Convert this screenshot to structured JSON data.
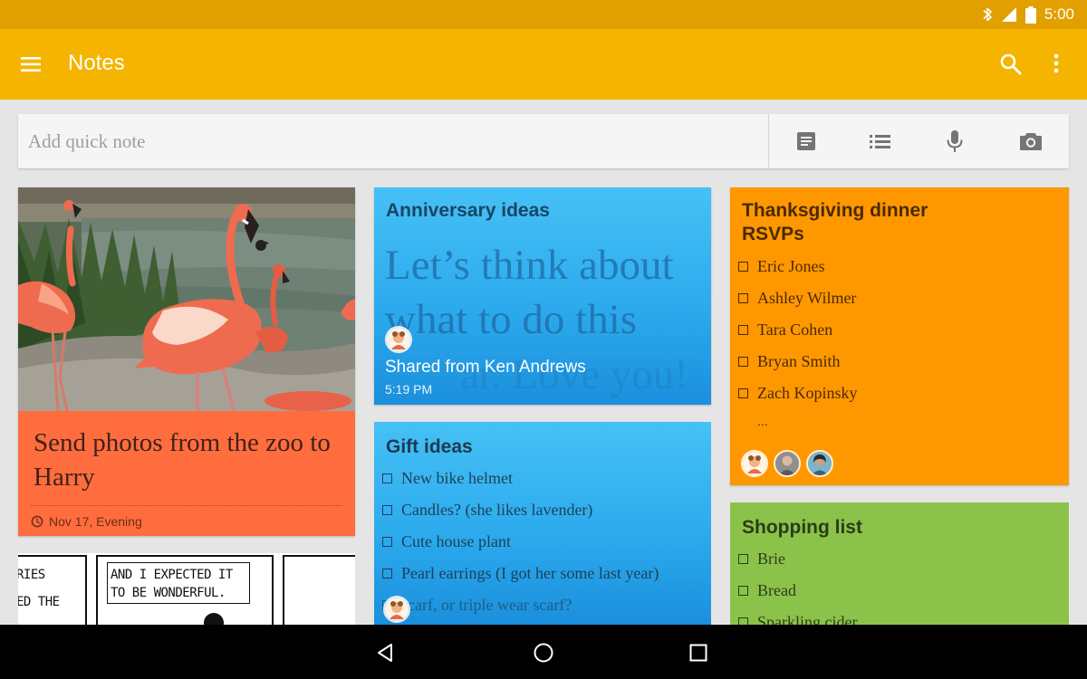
{
  "status_bar": {
    "time": "5:00",
    "icons": [
      "bluetooth-icon",
      "signal-icon",
      "battery-icon"
    ]
  },
  "app_bar": {
    "title": "Notes",
    "actions": [
      "search-icon",
      "more-vert-icon"
    ],
    "color": "#f4b400"
  },
  "quick_note": {
    "placeholder": "Add quick note",
    "actions": [
      "text-note-icon",
      "list-note-icon",
      "mic-icon",
      "camera-icon"
    ]
  },
  "notes": {
    "flamingo": {
      "text": "Send photos from the zoo to Harry",
      "reminder": "Nov 17, Evening",
      "color": "#ff6d3f"
    },
    "comic": {
      "lines": [
        "AND I EXPECTED IT",
        "TO BE WONDERFUL."
      ],
      "left_lines": [
        "RIES",
        "ED THE"
      ]
    },
    "anniversary": {
      "title": "Anniversary ideas",
      "body": "Let’s think about what to do this",
      "ghost": "ar. Love you!",
      "shared": "Shared from Ken Andrews",
      "time": "5:19 PM"
    },
    "gift": {
      "title": "Gift ideas",
      "items": [
        "New bike helmet",
        "Candles? (she likes lavender)",
        "Cute house plant",
        "Pearl earrings (I got her some last year)",
        "scarf, or triple wear scarf?"
      ]
    },
    "thanksgiving": {
      "title_line1": "Thanksgiving dinner",
      "title_line2": "RSVPs",
      "items": [
        "Eric Jones",
        "Ashley Wilmer",
        "Tara Cohen",
        "Bryan Smith",
        "Zach Kopinsky"
      ],
      "more": "...",
      "color": "#ff9800"
    },
    "shopping": {
      "title": "Shopping list",
      "items": [
        "Brie",
        "Bread",
        "Sparkling cider"
      ],
      "color": "#8bc34a"
    }
  },
  "nav_bar": {
    "buttons": [
      "back-icon",
      "home-icon",
      "recents-icon"
    ]
  }
}
